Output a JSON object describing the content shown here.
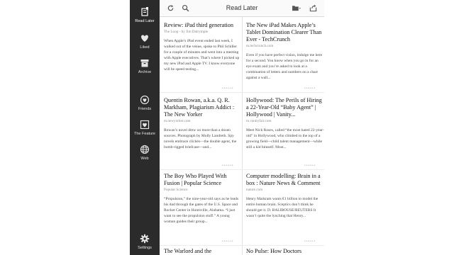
{
  "app": {
    "title": "Read Later"
  },
  "sidebar": {
    "items": [
      {
        "label": "Read Later",
        "icon": "read-later-icon",
        "active": true
      },
      {
        "label": "Liked",
        "icon": "heart-icon",
        "active": false
      },
      {
        "label": "Archive",
        "icon": "archive-icon",
        "active": false
      },
      {
        "label": "Friends",
        "icon": "friends-icon",
        "active": false
      },
      {
        "label": "The Feature",
        "icon": "feature-icon",
        "active": false
      },
      {
        "label": "Web",
        "icon": "globe-icon",
        "active": false
      },
      {
        "label": "Settings",
        "icon": "gear-icon",
        "active": false
      }
    ]
  },
  "toolbar": {
    "icons": [
      "refresh-icon",
      "search-icon",
      "folder-icon",
      "share-icon"
    ]
  },
  "articles": [
    {
      "title": "Review: iPad third generation",
      "source": "The Loop - by Jim Dalrymple",
      "excerpt": "When Apple’s iPad event ended last week, I walked out of the venue, spoke to Phil Schiller for a couple of minutes and went into a meeting with Apple executives. That’s where I picked up my new iPad and Apple TV. I know everyone will be speed testing..."
    },
    {
      "title": "The New iPad Makes Apple’s Tablet Domination Clearer Than Ever - TechCrunch",
      "source": "m.techcrunch.com",
      "excerpt": "Even if you have perfect vision, indulge me here for a second. You know when you go in for an eye exam and you’re asked to look at a combination of letters and numbers on a chart against a wall..."
    },
    {
      "title": "Quentin Rowan, a.k.a. Q. R. Markham, Plagiarism Addict : The New Yorker",
      "source": "m.newyorker.com",
      "excerpt": "Rowan’s novel drew on more than a dozen sources. Photograph by Molly Landreth. Spy novels embrace clichés—the double agent, the bomb-rigged briefcase—and..."
    },
    {
      "title": "Hollywood: The Perils of Hiring a 22-Year-Old “Baby Agent” | Hollywood | Vanity...",
      "source": "m.vanityfair.com",
      "excerpt": "Meet Nick Roses, called “the most hated 22-year-old” in Hollywood, who climbed to the top of a growing field—child talent management—while still a kid himself. Most..."
    },
    {
      "title": "The Boy Who Played With Fusion | Popular Science",
      "source": "Popular Science",
      "excerpt": "“Propulsion,” the nine-year-old says as he leads his dad through the gates of the U.S. Space and Rocket Center in Huntsville, Alabama. “I just want to see the propulsion stuff.” A young woman guides their group..."
    },
    {
      "title": "Computer modelling: Brain in a box : Nature News & Comment",
      "source": "nature.com",
      "excerpt": "Henry Markram wants €1 billion to model the entire human brain. Sceptics don’t think he should get it. D. BALIBOUSE/REUTERS It wasn’t quite the lynching that Henry..."
    },
    {
      "title": "The Warlord and the",
      "source": "",
      "excerpt": ""
    },
    {
      "title": "No Pulse: How Doctors",
      "source": "",
      "excerpt": ""
    }
  ]
}
